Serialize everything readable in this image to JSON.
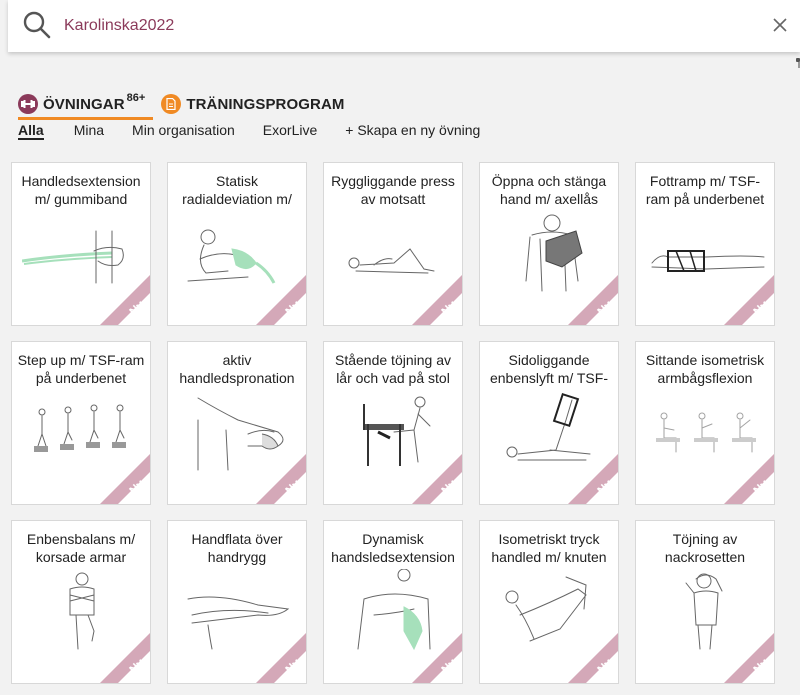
{
  "search": {
    "query": "Karolinska2022"
  },
  "tabs": [
    {
      "label": "ÖVNINGAR",
      "count": "86+"
    },
    {
      "label": "TRÄNINGSPROGRAM"
    }
  ],
  "filters": [
    "Alla",
    "Mina",
    "Min organisation",
    "ExorLive",
    "+ Skapa en ny övning"
  ],
  "badge": "Ny",
  "colors": {
    "brand": "#8b3a5a",
    "accent": "#f08a24",
    "ribbon": "#d4a8b8",
    "band_green": "#a6e0bb"
  },
  "cards": [
    {
      "title": "Handledsextension m/ gummiband",
      "illustration": "wrist-extension-band"
    },
    {
      "title": "Statisk radialdeviation m/",
      "illustration": "radial-deviation"
    },
    {
      "title": "Ryggliggande press av motsatt",
      "illustration": "supine-press"
    },
    {
      "title": "Öppna och stänga hand m/ axellås",
      "illustration": "hand-open-close-sling"
    },
    {
      "title": "Fottramp m/ TSF-ram på underbenet",
      "illustration": "foot-stomp-frame"
    },
    {
      "title": "Step up m/ TSF-ram på underbenet",
      "illustration": "step-up-sequence"
    },
    {
      "title": "aktiv handledspronation",
      "illustration": "wrist-pronation"
    },
    {
      "title": "Stående töjning av lår och vad på stol",
      "illustration": "standing-stretch-chair"
    },
    {
      "title": "Sidoliggande enbenslyft m/ TSF-",
      "illustration": "side-lying-leg-lift"
    },
    {
      "title": "Sittande isometrisk armbågsflexion",
      "illustration": "seated-elbow-flexion"
    },
    {
      "title": "Enbensbalans m/ korsade armar",
      "illustration": "single-leg-balance"
    },
    {
      "title": "Handflata över handrygg",
      "illustration": "palm-over-back-of-hand"
    },
    {
      "title": "Dynamisk handsledsextension",
      "illustration": "dynamic-wrist-extension"
    },
    {
      "title": "Isometriskt tryck handled m/ knuten",
      "illustration": "isometric-wrist-press"
    },
    {
      "title": "Töjning av nackrosetten",
      "illustration": "neck-stretch"
    }
  ]
}
